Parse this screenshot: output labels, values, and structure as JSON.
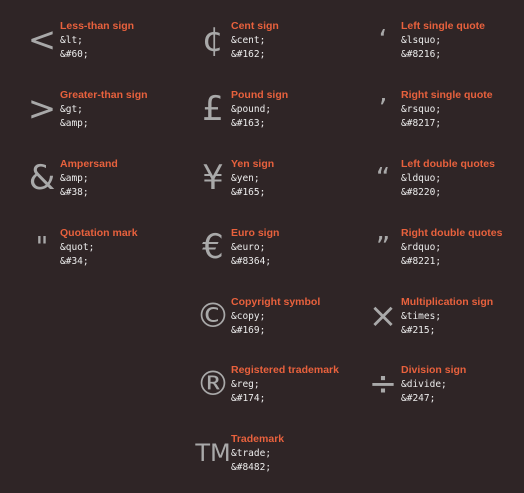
{
  "entries": [
    {
      "glyph": "<",
      "name": "Less-than sign",
      "code1": "&lt;",
      "code2": "&#60;",
      "icon": "less-than-icon"
    },
    {
      "glyph": ">",
      "name": "Greater-than sign",
      "code1": "&gt;",
      "code2": "&amp;",
      "icon": "greater-than-icon"
    },
    {
      "glyph": "&",
      "name": "Ampersand",
      "code1": "&amp;",
      "code2": "&#38;",
      "icon": "ampersand-icon"
    },
    {
      "glyph": "\"",
      "name": "Quotation mark",
      "code1": "&quot;",
      "code2": "&#34;",
      "icon": "quotation-mark-icon"
    },
    {
      "glyph": "¢",
      "name": "Cent sign",
      "code1": "&cent;",
      "code2": "&#162;",
      "icon": "cent-icon"
    },
    {
      "glyph": "£",
      "name": "Pound sign",
      "code1": "&pound;",
      "code2": "&#163;",
      "icon": "pound-icon"
    },
    {
      "glyph": "¥",
      "name": "Yen sign",
      "code1": "&yen;",
      "code2": "&#165;",
      "icon": "yen-icon"
    },
    {
      "glyph": "€",
      "name": "Euro sign",
      "code1": "&euro;",
      "code2": "&#8364;",
      "icon": "euro-icon"
    },
    {
      "glyph": "©",
      "name": "Copyright symbol",
      "code1": "&copy;",
      "code2": "&#169;",
      "icon": "copyright-icon"
    },
    {
      "glyph": "®",
      "name": "Registered trademark",
      "code1": "&reg;",
      "code2": "&#174;",
      "icon": "registered-icon"
    },
    {
      "glyph": "TM",
      "name": "Trademark",
      "code1": "&trade;",
      "code2": "&#8482;",
      "icon": "trademark-icon"
    },
    {
      "glyph": "‘",
      "name": "Left single quote",
      "code1": "&lsquo;",
      "code2": "&#8216;",
      "icon": "left-single-quote-icon"
    },
    {
      "glyph": "’",
      "name": "Right single quote",
      "code1": "&rsquo;",
      "code2": "&#8217;",
      "icon": "right-single-quote-icon"
    },
    {
      "glyph": "“",
      "name": "Left double quotes",
      "code1": "&ldquo;",
      "code2": "&#8220;",
      "icon": "left-double-quote-icon"
    },
    {
      "glyph": "”",
      "name": "Right double quotes",
      "code1": "&rdquo;",
      "code2": "&#8221;",
      "icon": "right-double-quote-icon"
    },
    {
      "glyph": "×",
      "name": "Multiplication sign",
      "code1": "&times;",
      "code2": "&#215;",
      "icon": "multiplication-icon"
    },
    {
      "glyph": "÷",
      "name": "Division sign",
      "code1": "&divide;",
      "code2": "&#247;",
      "icon": "division-icon"
    }
  ],
  "colors": {
    "background": "#2f2526",
    "name": "#e8613d",
    "code": "#ececec",
    "glyph": "#a9a9a9"
  }
}
